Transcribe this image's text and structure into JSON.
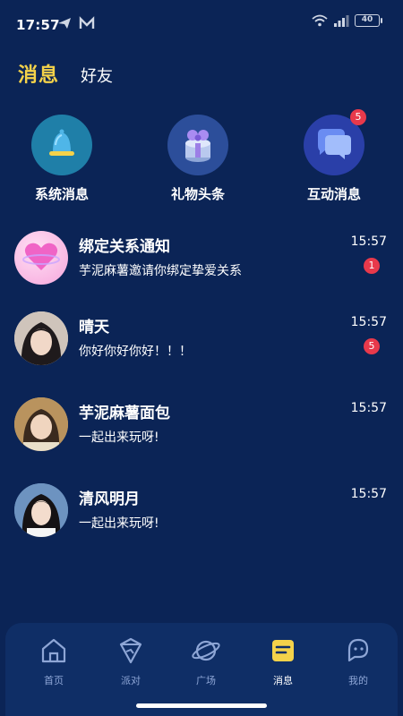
{
  "status_bar": {
    "time": "17:57",
    "battery": "40"
  },
  "tabs": [
    {
      "label": "消息",
      "active": true
    },
    {
      "label": "好友",
      "active": false
    }
  ],
  "categories": [
    {
      "label": "系统消息",
      "icon": "bell-icon",
      "badge": ""
    },
    {
      "label": "礼物头条",
      "icon": "gift-box-icon",
      "badge": ""
    },
    {
      "label": "互动消息",
      "icon": "chat-bubbles-icon",
      "badge": "5"
    }
  ],
  "messages": [
    {
      "name": "绑定关系通知",
      "preview": "芋泥麻薯邀请你绑定挚爱关系",
      "time": "15:57",
      "badge": "1",
      "avatar": "pink-heart-avatar"
    },
    {
      "name": "晴天",
      "preview": "你好你好你好！！！",
      "time": "15:57",
      "badge": "5",
      "avatar": "user-photo-avatar"
    },
    {
      "name": "芋泥麻薯面包",
      "preview": "一起出来玩呀!",
      "time": "15:57",
      "badge": "",
      "avatar": "user-photo-avatar"
    },
    {
      "name": "清风明月",
      "preview": "一起出来玩呀!",
      "time": "15:57",
      "badge": "",
      "avatar": "user-photo-avatar"
    }
  ],
  "bottom_nav": [
    {
      "label": "首页",
      "icon": "home-icon",
      "active": false
    },
    {
      "label": "派对",
      "icon": "party-icon",
      "active": false
    },
    {
      "label": "广场",
      "icon": "planet-icon",
      "active": false
    },
    {
      "label": "消息",
      "icon": "message-icon",
      "active": true
    },
    {
      "label": "我的",
      "icon": "profile-icon",
      "active": false
    }
  ],
  "colors": {
    "background": "#0b2456",
    "accent": "#f4d24a",
    "badge": "#e8394b",
    "nav_bg": "#0f2e66"
  }
}
